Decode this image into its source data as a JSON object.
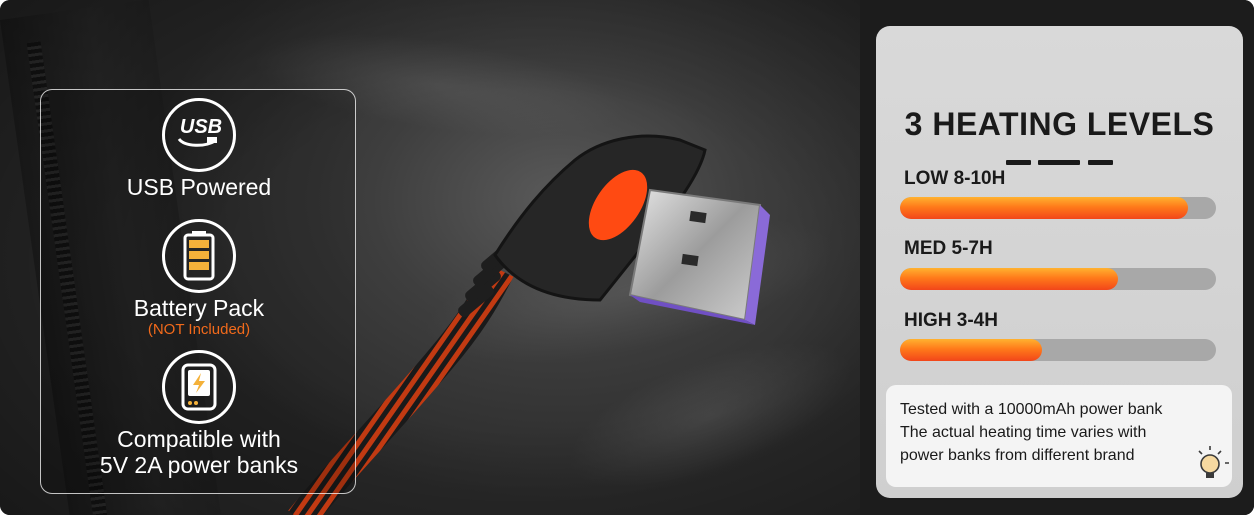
{
  "features": [
    {
      "label_lines": [
        "USB Powered"
      ],
      "note": "",
      "icon": "usb-icon",
      "icon_text": "USB"
    },
    {
      "label_lines": [
        "Battery Pack"
      ],
      "note": "(NOT Included)",
      "icon": "battery-icon"
    },
    {
      "label_lines": [
        "Compatible with",
        "5V 2A power banks"
      ],
      "note": "",
      "icon": "power-bank-icon"
    }
  ],
  "levels_panel": {
    "title": "3 HEATING LEVELS",
    "levels": [
      {
        "label": "LOW 8-10H",
        "fill": 0.91
      },
      {
        "label": "MED 5-7H",
        "fill": 0.69
      },
      {
        "label": "HIGH 3-4H",
        "fill": 0.45
      }
    ],
    "note_lines": [
      "Tested with a 10000mAh power bank",
      "The actual heating time varies with",
      "power banks from different brand"
    ],
    "note_icon": "lightbulb-icon"
  },
  "colors": {
    "accent": "#f26a1b",
    "bar_track": "#a8a8a8",
    "panel": "#d6d6d6"
  }
}
